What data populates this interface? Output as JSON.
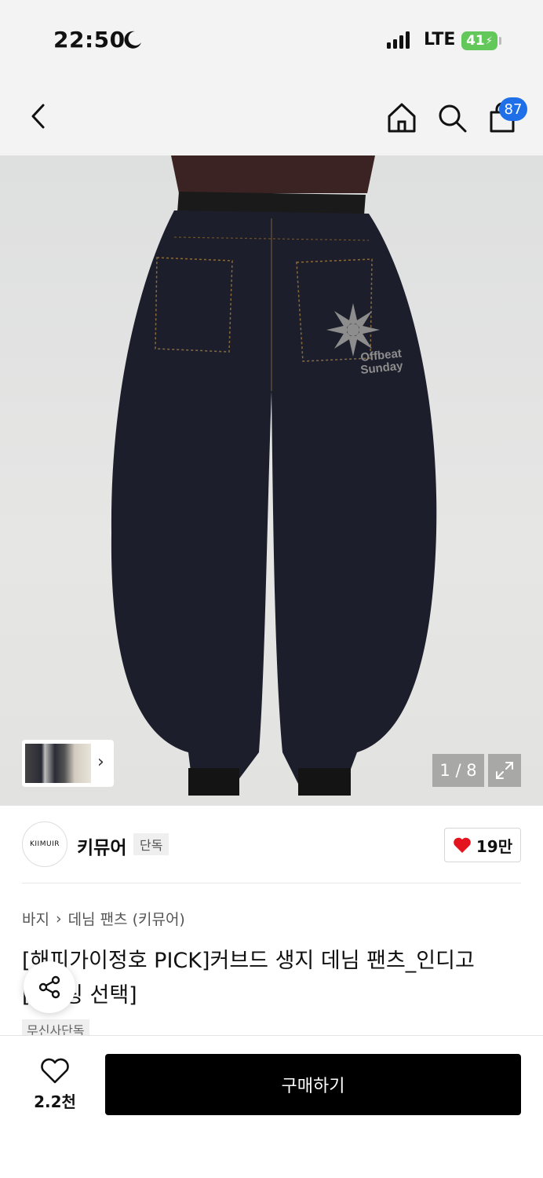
{
  "status_bar": {
    "time": "22:50",
    "network": "LTE",
    "battery": "41"
  },
  "nav": {
    "cart_count": "87"
  },
  "gallery": {
    "page_indicator": "1 / 8",
    "thumb_arrow": "›",
    "print_line1": "Offbeat",
    "print_line2": "Sunday"
  },
  "brand": {
    "logo_text": "KIIMUIR",
    "name": "키뮤어",
    "tag": "단독",
    "likes": "19만"
  },
  "breadcrumb": {
    "category": "바지",
    "separator": "›",
    "subcategory": "데님 팬츠 (키뮤어)"
  },
  "product": {
    "title_line1": "[해피가이정호 PICK]커브드 생지 데님 팬츠_인디고",
    "title_line2": "[     /키링 선택]",
    "tag": "무신사단독"
  },
  "bottom_bar": {
    "wish_count": "2.2천",
    "buy_label": "구매하기"
  },
  "colors": {
    "accent": "#1f6fe8",
    "heart": "#e4141e",
    "buy_bg": "#000000",
    "battery": "#62c85a"
  }
}
